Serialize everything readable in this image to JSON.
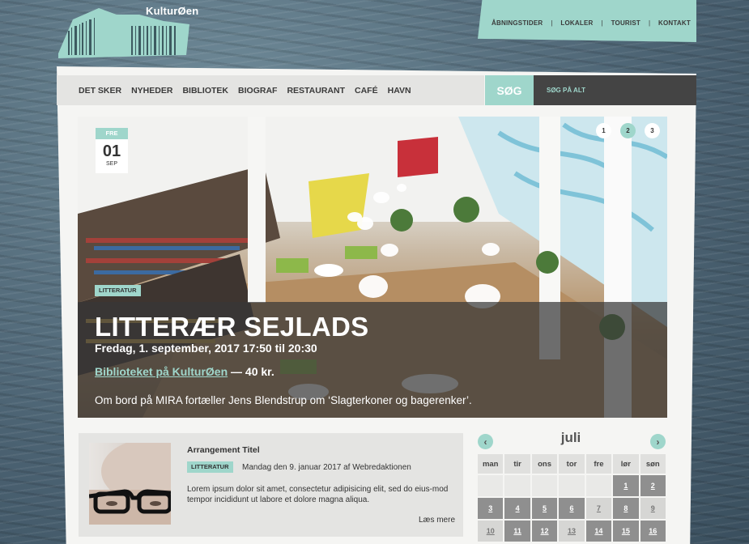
{
  "logo": {
    "text": "KulturØen"
  },
  "topnav": {
    "items": [
      "ÅBNINGSTIDER",
      "LOKALER",
      "TOURIST",
      "KONTAKT"
    ],
    "separator": "|"
  },
  "mainnav": {
    "items": [
      "DET SKER",
      "NYHEDER",
      "BIBLIOTEK",
      "BIOGRAF",
      "RESTAURANT",
      "CAFÉ",
      "HAVN"
    ]
  },
  "search": {
    "button": "SØG",
    "placeholder": "SØG PÅ ALT"
  },
  "hero": {
    "date": {
      "day": "FRE",
      "number": "01",
      "month": "SEP"
    },
    "slides": [
      "1",
      "2",
      "3"
    ],
    "active_slide": 2,
    "tag": "LITTERATUR",
    "title": "LITTERÆR SEJLADS",
    "datetime": "Fredag, 1. september, 2017 17:50 til 20:30",
    "venue": "Biblioteket på KulturØen",
    "price": " — 40 kr.",
    "description": "Om bord på MIRA fortæller Jens Blendstrup om ‘Slagterkoner og bagerenker’."
  },
  "article": {
    "title": "Arrangement Titel",
    "tag": "LITTERATUR",
    "meta": "Mandag den 9. januar 2017 af Webredaktionen",
    "body": "Lorem ipsum dolor sit amet, consectetur adipisicing elit, sed do eius-mod tempor incididunt ut labore et dolore magna aliqua.",
    "more": "Læs mere"
  },
  "calendar": {
    "month": "juli",
    "prev": "‹",
    "next": "›",
    "weekdays": [
      "man",
      "tir",
      "ons",
      "tor",
      "fre",
      "lør",
      "søn"
    ],
    "days": [
      "",
      "",
      "",
      "",
      "",
      "1",
      "2",
      "3",
      "4",
      "5",
      "6",
      "7",
      "8",
      "9",
      "10",
      "11",
      "12",
      "13",
      "14",
      "15",
      "16"
    ],
    "light_days": [
      "7",
      "9",
      "10",
      "13"
    ]
  },
  "colors": {
    "accent": "#9fd6cb",
    "dark": "#444444",
    "nav_bg": "#e4e4e2"
  }
}
